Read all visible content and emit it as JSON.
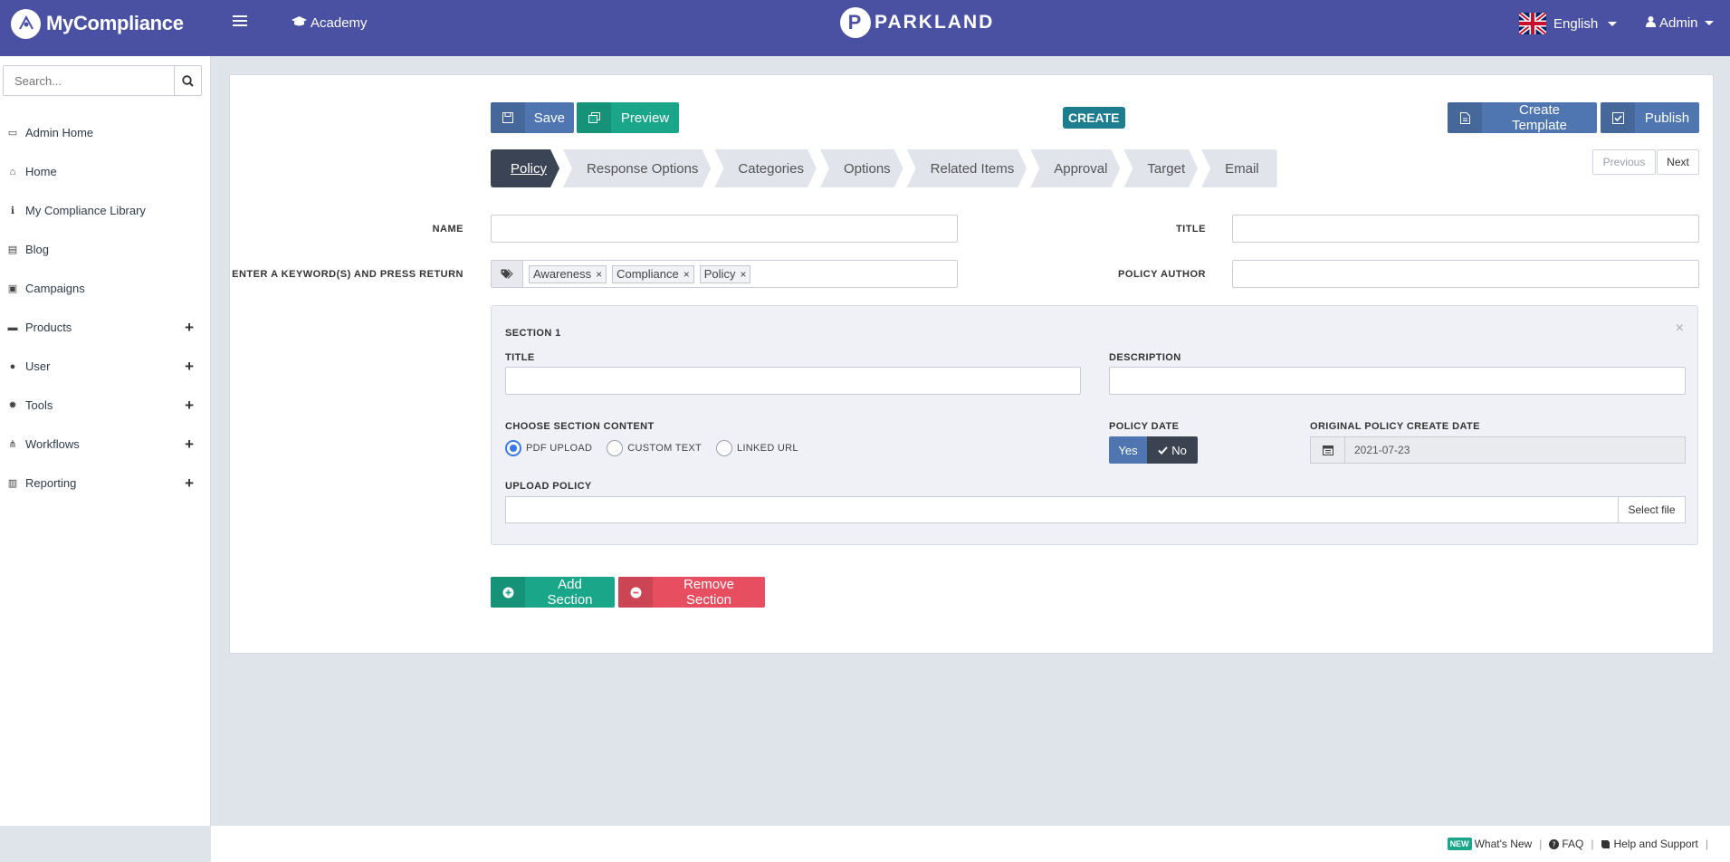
{
  "header": {
    "app_name": "MyCompliance",
    "academy_label": "Academy",
    "company_logo_text": "PARKLAND",
    "company_logo_mark": "P",
    "language": "English",
    "user": "Admin"
  },
  "sidebar": {
    "search_placeholder": "Search...",
    "items": [
      {
        "label": "Admin Home",
        "icon": "dashboard-icon",
        "glyph": "▭",
        "expandable": false
      },
      {
        "label": "Home",
        "icon": "home-icon",
        "glyph": "⌂",
        "expandable": false
      },
      {
        "label": "My Compliance Library",
        "icon": "info-icon",
        "glyph": "ℹ",
        "expandable": false
      },
      {
        "label": "Blog",
        "icon": "document-icon",
        "glyph": "▤",
        "expandable": false
      },
      {
        "label": "Campaigns",
        "icon": "book-icon",
        "glyph": "▣",
        "expandable": false
      },
      {
        "label": "Products",
        "icon": "laptop-icon",
        "glyph": "▬",
        "expandable": true
      },
      {
        "label": "User",
        "icon": "user-icon",
        "glyph": "●",
        "expandable": true
      },
      {
        "label": "Tools",
        "icon": "cog-icon",
        "glyph": "✹",
        "expandable": true
      },
      {
        "label": "Workflows",
        "icon": "sitemap-icon",
        "glyph": "⋔",
        "expandable": true
      },
      {
        "label": "Reporting",
        "icon": "bar-chart-icon",
        "glyph": "▥",
        "expandable": true
      }
    ],
    "expand_symbol": "+"
  },
  "toolbar": {
    "save_label": "Save",
    "preview_label": "Preview",
    "mode_badge": "CREATE",
    "create_template_label": "Create Template",
    "publish_label": "Publish"
  },
  "steps": [
    "Policy",
    "Response Options",
    "Categories",
    "Options",
    "Related Items",
    "Approval",
    "Target",
    "Email"
  ],
  "active_step": "Policy",
  "pager": {
    "previous": "Previous",
    "next": "Next"
  },
  "form": {
    "name_label": "NAME",
    "name_value": "",
    "title_label": "TITLE",
    "title_value": "",
    "keywords_label": "ENTER A KEYWORD(S) AND PRESS RETURN",
    "keywords": [
      "Awareness",
      "Compliance",
      "Policy"
    ],
    "tag_remove_symbol": "×",
    "author_label": "POLICY AUTHOR",
    "author_value": ""
  },
  "section": {
    "heading": "SECTION 1",
    "close_symbol": "×",
    "title_label": "TITLE",
    "title_value": "",
    "description_label": "DESCRIPTION",
    "description_value": "",
    "content_label": "CHOOSE SECTION CONTENT",
    "content_options": [
      "PDF UPLOAD",
      "CUSTOM TEXT",
      "LINKED URL"
    ],
    "content_selected": "PDF UPLOAD",
    "policy_date_label": "POLICY DATE",
    "policy_date_yes": "Yes",
    "policy_date_no": "No",
    "policy_date_selected": "No",
    "original_date_label": "ORIGINAL POLICY CREATE DATE",
    "original_date_value": "2021-07-23",
    "upload_label": "UPLOAD POLICY",
    "select_file_label": "Select file"
  },
  "actions": {
    "add_section_label": "Add Section",
    "remove_section_label": "Remove Section"
  },
  "footer": {
    "new_badge": "NEW",
    "whats_new": "What's New",
    "faq": "FAQ",
    "help": "Help and Support",
    "separator": "|"
  },
  "colors": {
    "header_bg": "#4a51a2",
    "primary_blue": "#4f76b0",
    "teal": "#1aa789",
    "red": "#e74f60",
    "active_step": "#3a4454",
    "badge": "#1d7d8f"
  }
}
